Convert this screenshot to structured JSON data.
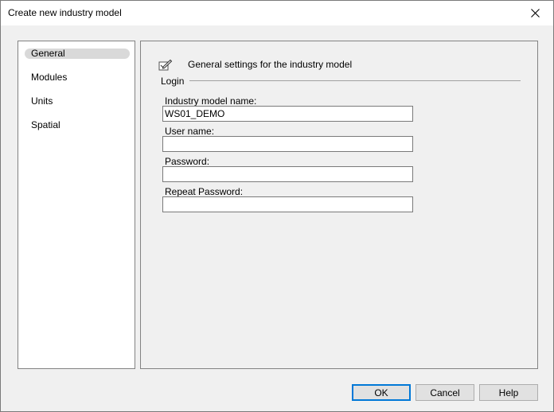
{
  "window": {
    "title": "Create new industry model"
  },
  "sidebar": {
    "items": [
      {
        "label": "General",
        "selected": true
      },
      {
        "label": "Modules",
        "selected": false
      },
      {
        "label": "Units",
        "selected": false
      },
      {
        "label": "Spatial",
        "selected": false
      }
    ]
  },
  "panel": {
    "header_icon": "edit-document-icon",
    "header_text": "General settings for the industry model",
    "group_label": "Login",
    "fields": [
      {
        "label": "Industry model name:",
        "value": "WS01_DEMO",
        "type": "text"
      },
      {
        "label": "User name:",
        "value": "",
        "type": "text"
      },
      {
        "label": "Password:",
        "value": "",
        "type": "password"
      },
      {
        "label": "Repeat Password:",
        "value": "",
        "type": "password"
      }
    ]
  },
  "buttons": {
    "ok": "OK",
    "cancel": "Cancel",
    "help": "Help"
  },
  "colors": {
    "accent": "#0078d7",
    "selection": "#d9d9d9",
    "background": "#f0f0f0"
  }
}
